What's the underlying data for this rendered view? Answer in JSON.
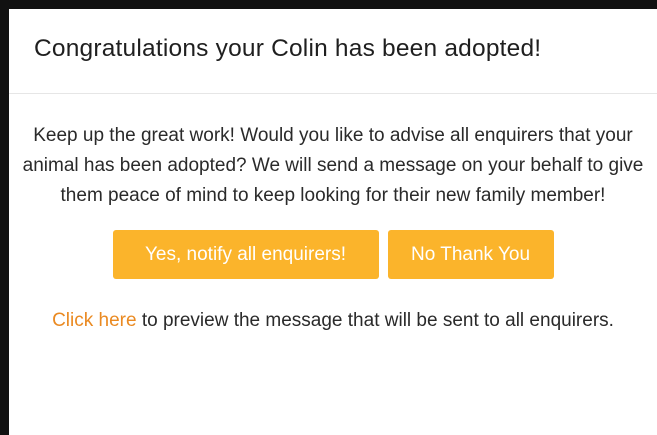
{
  "modal": {
    "title": "Congratulations your Colin has been adopted!",
    "message": "Keep up the great work! Would you like to advise all enquirers that your animal has been adopted? We will send a message on your behalf to give them peace of mind to keep looking for their new family member!",
    "buttons": {
      "yes_label": "Yes, notify all enquirers!",
      "no_label": "No Thank You"
    },
    "preview": {
      "link_text": "Click here",
      "rest_text": " to preview the message that will be sent to all enquirers."
    }
  },
  "colors": {
    "accent_button": "#fbb42b",
    "link": "#ea8a22",
    "text": "#2a2a2a",
    "frame": "#111111"
  }
}
